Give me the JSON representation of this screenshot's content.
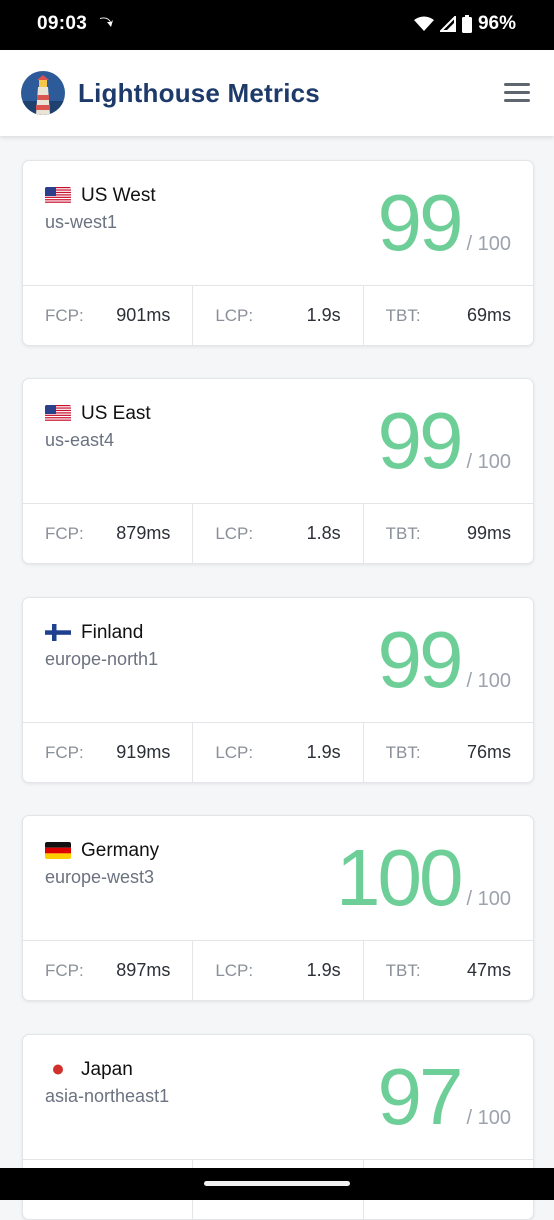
{
  "status_bar": {
    "time": "09:03",
    "battery": "96%"
  },
  "header": {
    "title": "Lighthouse Metrics"
  },
  "regions": [
    {
      "name": "US West",
      "code": "us-west1",
      "flag": "us",
      "score": "99",
      "max": "/ 100",
      "fcp_label": "FCP:",
      "fcp": "901ms",
      "lcp_label": "LCP:",
      "lcp": "1.9s",
      "tbt_label": "TBT:",
      "tbt": "69ms"
    },
    {
      "name": "US East",
      "code": "us-east4",
      "flag": "us",
      "score": "99",
      "max": "/ 100",
      "fcp_label": "FCP:",
      "fcp": "879ms",
      "lcp_label": "LCP:",
      "lcp": "1.8s",
      "tbt_label": "TBT:",
      "tbt": "99ms"
    },
    {
      "name": "Finland",
      "code": "europe-north1",
      "flag": "fi",
      "score": "99",
      "max": "/ 100",
      "fcp_label": "FCP:",
      "fcp": "919ms",
      "lcp_label": "LCP:",
      "lcp": "1.9s",
      "tbt_label": "TBT:",
      "tbt": "76ms"
    },
    {
      "name": "Germany",
      "code": "europe-west3",
      "flag": "de",
      "score": "100",
      "max": "/ 100",
      "fcp_label": "FCP:",
      "fcp": "897ms",
      "lcp_label": "LCP:",
      "lcp": "1.9s",
      "tbt_label": "TBT:",
      "tbt": "47ms"
    },
    {
      "name": "Japan",
      "code": "asia-northeast1",
      "flag": "jp",
      "score": "97",
      "max": "/ 100",
      "fcp_label": "FCP:",
      "fcp": "",
      "lcp_label": "LCP:",
      "lcp": "",
      "tbt_label": "TBT:",
      "tbt": ""
    }
  ],
  "colors": {
    "score": "#6dcf97",
    "brand": "#1e3a6b",
    "background": "#f5f6f7"
  }
}
